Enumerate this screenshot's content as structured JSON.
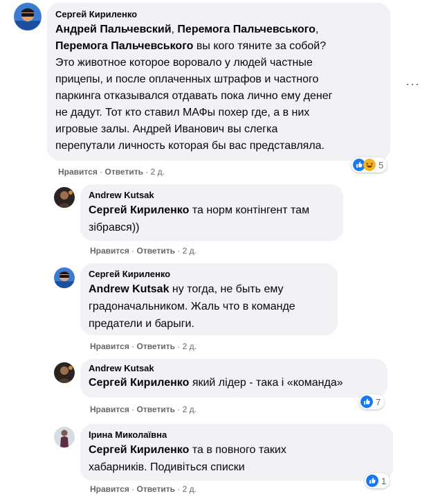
{
  "comments": [
    {
      "author": "Сергей Кириленко",
      "mentions": [
        "Андрей Пальчевский",
        "Перемога Пальчевського"
      ],
      "mention3": "Перемога Пальчевського",
      "text_lines": [
        " вы кого тяните за собой?",
        "Это животное которое воровало у людей частные",
        "прицепы, и после оплаченных штрафов и частного",
        "паркинга отказывался отдавать пока лично ему денег",
        "не дадут. Тот кто ставил МАФы похер где, а в них",
        "игровые залы. Андрей Иванович вы слегка",
        "перепутали личность которая бы вас представляла."
      ],
      "like": "Нравится",
      "reply": "Ответить",
      "time": "2 д.",
      "reactions_count": "5"
    },
    {
      "author": "Andrew Kutsak",
      "mention": "Сергей Кириленко",
      "text_line1": " та норм контінгент там",
      "text_line2": "зібрався))",
      "like": "Нравится",
      "reply": "Ответить",
      "time": "2 д."
    },
    {
      "author": "Сергей Кириленко",
      "mention": "Andrew Kutsak",
      "text_line1": " ну тогда, не быть ему",
      "text_line2": "градоначальником. Жаль что в команде",
      "text_line3": "предатели и барыги.",
      "like": "Нравится",
      "reply": "Ответить",
      "time": "2 д."
    },
    {
      "author": "Andrew Kutsak",
      "mention": "Сергей Кириленко",
      "text_line1": " який лідер - така і «команда»",
      "like": "Нравится",
      "reply": "Ответить",
      "time": "2 д.",
      "reactions_count": "7"
    },
    {
      "author": "Ірина Миколаївна",
      "mention": "Сергей Кириленко",
      "text_line1": " та в повного таких",
      "text_line2": "хабарників. Подивіться списки",
      "like": "Нравится",
      "reply": "Ответить",
      "time": "2 д.",
      "reactions_count": "1"
    }
  ],
  "separator": " · ",
  "icons": {
    "like": "like-icon",
    "haha": "haha-icon",
    "more": "more-options-icon"
  },
  "colors": {
    "bubble": "#f0f2f5",
    "meta": "#65676b",
    "like_blue": "#1877f2",
    "haha_yellow": "#f7b125"
  }
}
